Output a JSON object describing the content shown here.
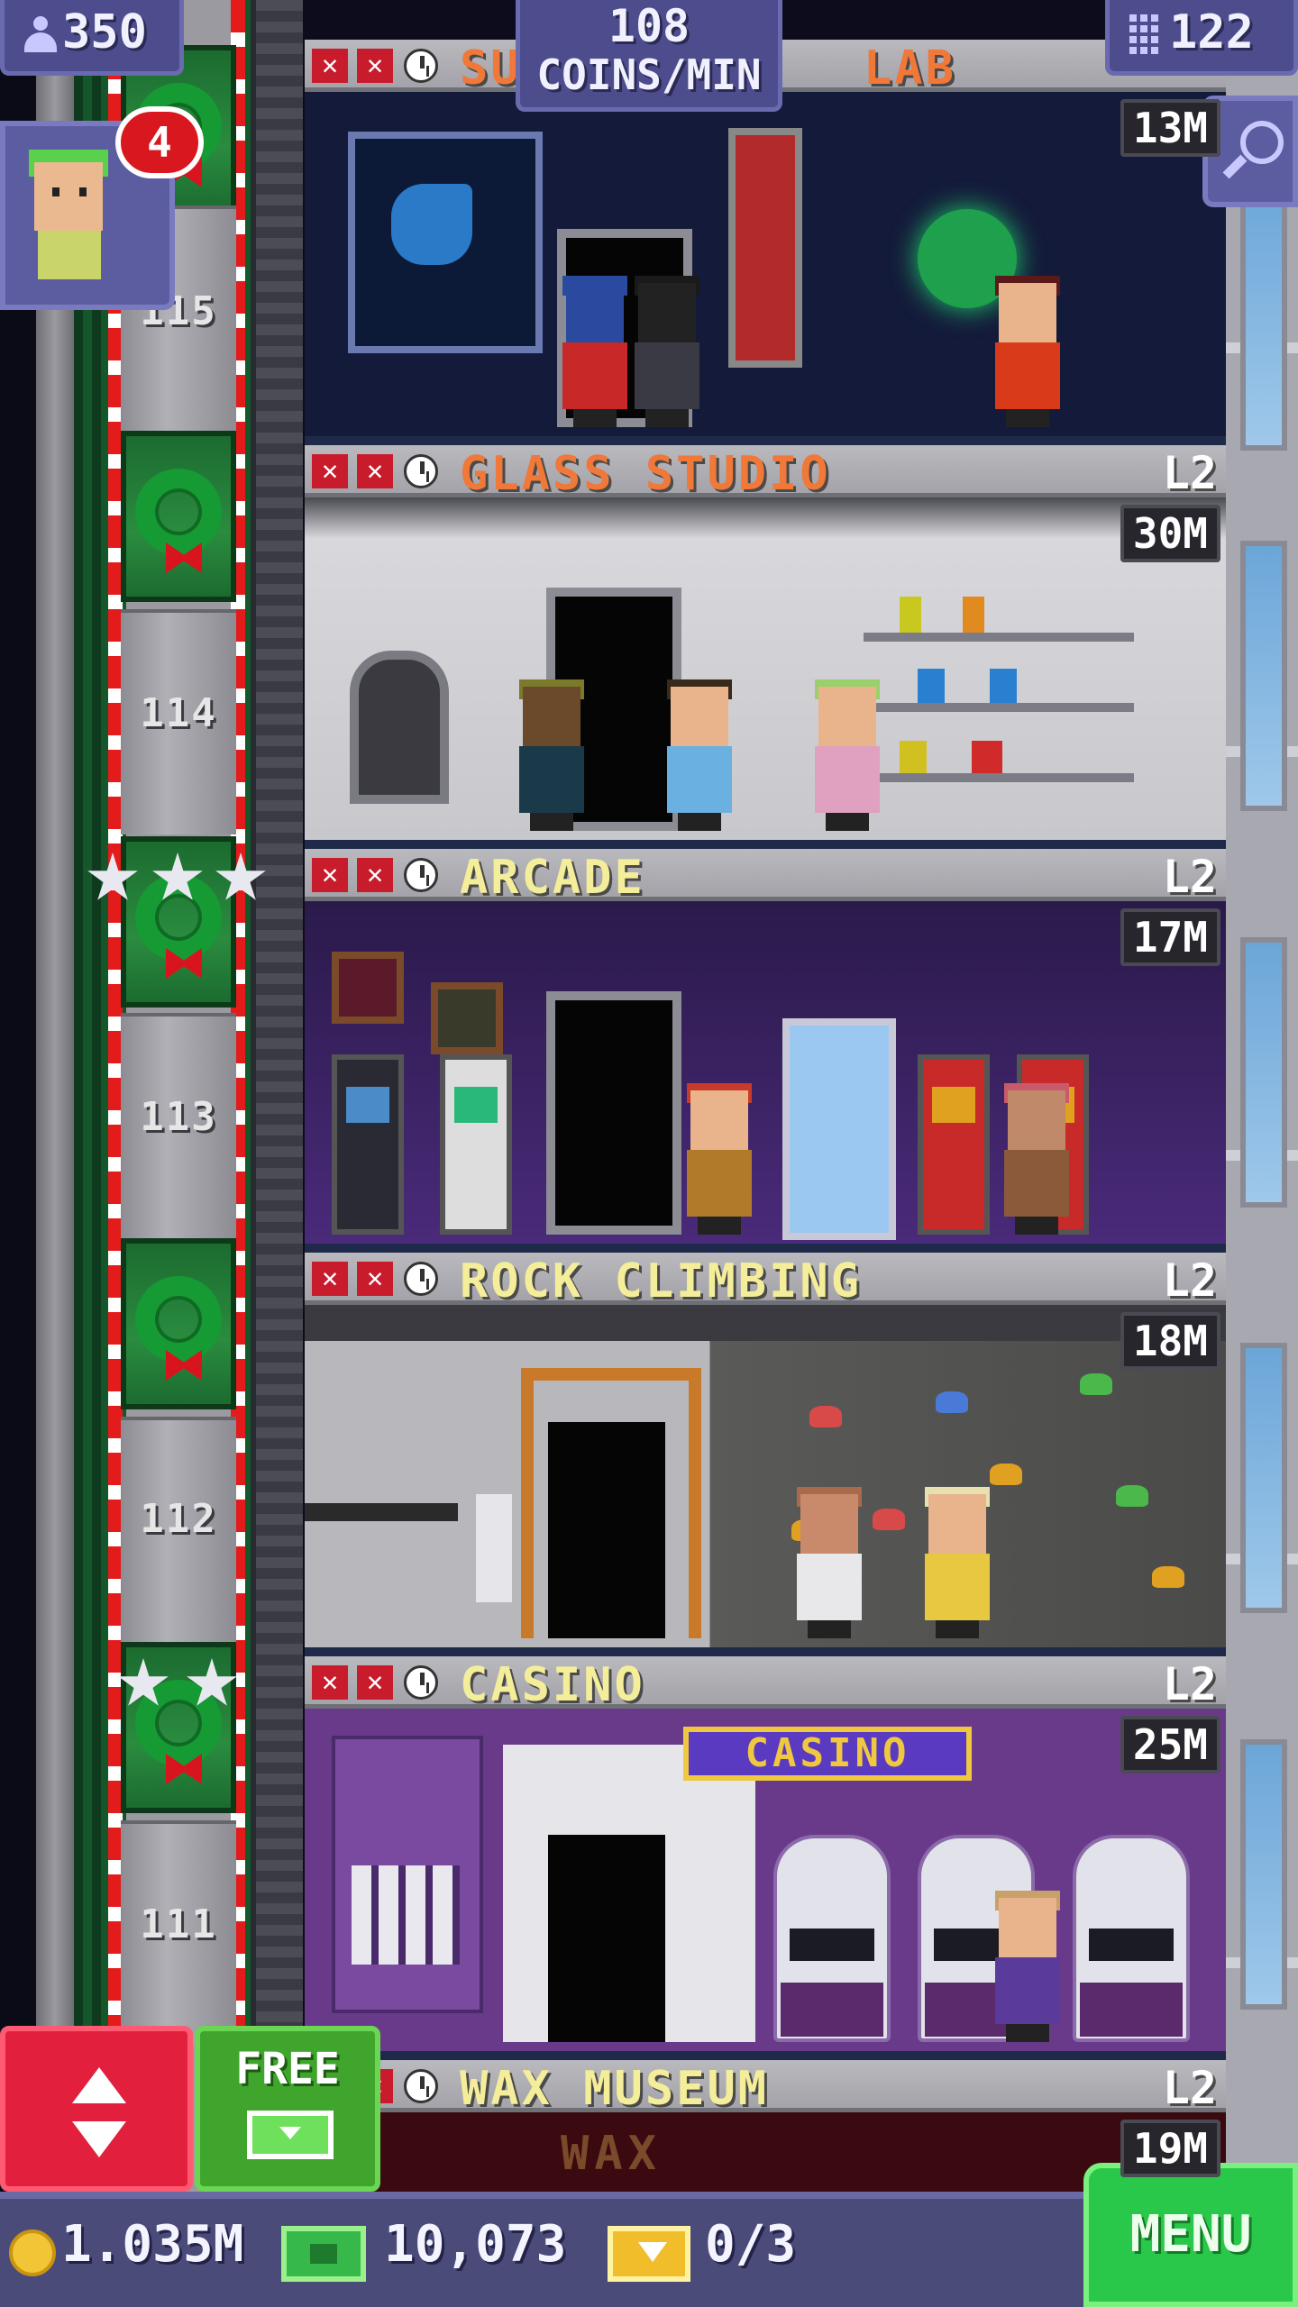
{
  "hud": {
    "population": "350",
    "coins_per_min_value": "108",
    "coins_per_min_label": "COINS/MIN",
    "stories": "122",
    "bitizen_badge": "4"
  },
  "elevator": {
    "floor_numbers": [
      "115",
      "114",
      "113",
      "112",
      "111"
    ]
  },
  "floors": [
    {
      "name": "SU",
      "name_tail": "LAB",
      "level": "",
      "stock": "13M",
      "name_color": "#f07838"
    },
    {
      "name": "GLASS STUDIO",
      "level": "L2",
      "stock": "30M",
      "name_color": "#f07838"
    },
    {
      "name": "ARCADE",
      "level": "L2",
      "stock": "17M",
      "name_color": "#f4ee9a"
    },
    {
      "name": "ROCK CLIMBING",
      "level": "L2",
      "stock": "18M",
      "name_color": "#f4ee9a"
    },
    {
      "name": "CASINO",
      "level": "L2",
      "stock": "25M",
      "name_color": "#f4ee9a"
    },
    {
      "name": "WAX MUSEUM",
      "level": "L2",
      "stock": "19M",
      "name_color": "#f4ee9a"
    }
  ],
  "room_signs": {
    "casino": "CASINO",
    "wax": "WAX"
  },
  "controls": {
    "free_label": "FREE",
    "menu_label": "MENU"
  },
  "bottom_bar": {
    "coins": "1.035M",
    "bux": "10,073",
    "tickets": "0/3"
  },
  "icons": {
    "population": "person-icon",
    "stories": "building-icon",
    "search": "magnifier-icon",
    "coin": "coin-icon",
    "bux": "bux-icon",
    "ticket": "golden-ticket-icon",
    "elevator": "up-down-arrows-icon",
    "free": "cash-icon",
    "stock_warning": "red-x-icon",
    "timer": "clock-icon"
  },
  "colors": {
    "hud_purple": "#4d4d8d",
    "menu_green": "#2ac84a",
    "elevator_red": "#e2203e",
    "free_green": "#3fa52c",
    "name_orange": "#f07838",
    "name_yellow": "#f4ee9a"
  }
}
